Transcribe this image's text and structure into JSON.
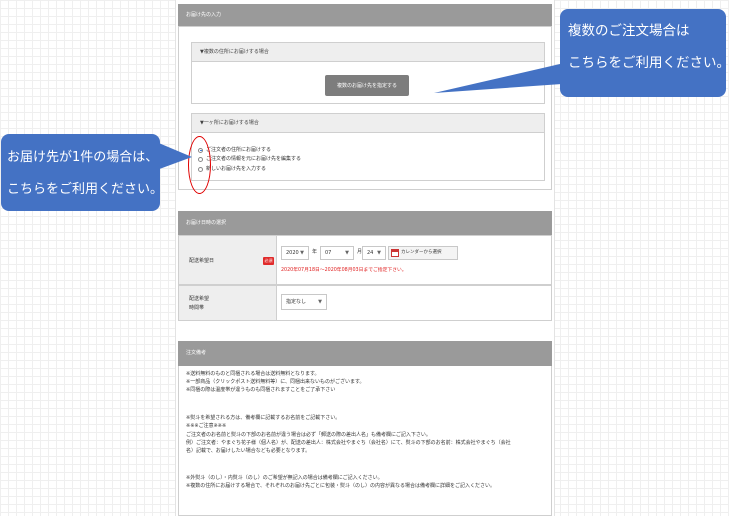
{
  "shipping_section": {
    "title": "お届け先の入力",
    "multiple": {
      "header": "▼複数の住所にお届けする場合",
      "button_label": "複数のお届け先を指定する"
    },
    "single": {
      "header": "▼一ヶ所にお届けする場合",
      "options": [
        {
          "label": "ご注文者の住所にお届けする",
          "checked": true
        },
        {
          "label": "ご注文者の情報を元にお届け先を編集する",
          "checked": false
        },
        {
          "label": "新しいお届け先を入力する",
          "checked": false
        }
      ]
    }
  },
  "callouts": {
    "left": {
      "line1": "お届け先が1件の場合は、",
      "line2": "こちらをご利用ください。"
    },
    "right": {
      "line1": "複数のご注文場合は",
      "line2": "こちらをご利用ください。"
    }
  },
  "delivery_section": {
    "title": "お届け日時の選択",
    "date_label": "配送希望日",
    "required_badge": "必須",
    "year": "2020",
    "year_unit": "年",
    "month": "07",
    "month_unit": "月",
    "day": "24",
    "day_unit": "日",
    "calendar_button": "カレンダーから選択",
    "date_note": "2020年07月18日～2020年08月03日までご指定下さい。",
    "time_label_line1": "配送希望",
    "time_label_line2": "時間帯",
    "time_value": "指定なし"
  },
  "notes_section": {
    "title": "注文備考",
    "lines": [
      {
        "text": "※送料無料のものと同梱される場合は送料無料となります。",
        "color": "normal"
      },
      {
        "text": "※一部商品（クリックポスト送料無料等）に、同梱出来ないものがございます。",
        "color": "normal"
      },
      {
        "text": "※同梱の際は温度帯が違うものも同梱されますことをご了承下さい",
        "color": "normal"
      },
      {
        "text": "",
        "color": "normal"
      },
      {
        "text": "※熨斗を希望される方は、備考欄に記載するお名前をご記載下さい。",
        "color": "red"
      },
      {
        "text": "※※※ご注意※※※",
        "color": "red"
      },
      {
        "text": "ご注文者のお名前と熨斗の下部のお名前が違う場合は必ず「郵送の際の差出人名」も備考欄にご記入下さい。",
        "color": "normal"
      },
      {
        "text": "例）ご注文者：やまぐち花子様（個人名）が、配送の差出人：株式会社やまぐち（会社名）にて、熨斗の下部のお名前：株式会社やまぐち（会社",
        "color": "normal"
      },
      {
        "text": "名）記載で、お届けしたい場合なども必要となります。",
        "color": "normal"
      },
      {
        "text": "",
        "color": "normal"
      },
      {
        "text": "※外熨斗（のし）・内熨斗（のし）のご希望が無記入の場合は備考欄にご記入ください。",
        "color": "red"
      },
      {
        "text": "※複数の住所にお届けする場合で、それぞれのお届け先ごとに包装・熨斗（のし）の内容が異なる場合は備考欄に詳細をご記入ください。",
        "color": "red"
      }
    ]
  },
  "colors": {
    "callout_bg": "#4472c4",
    "section_header": "#9a9a9a",
    "alert_red": "#e02020",
    "highlight_ellipse": "#e00000"
  }
}
